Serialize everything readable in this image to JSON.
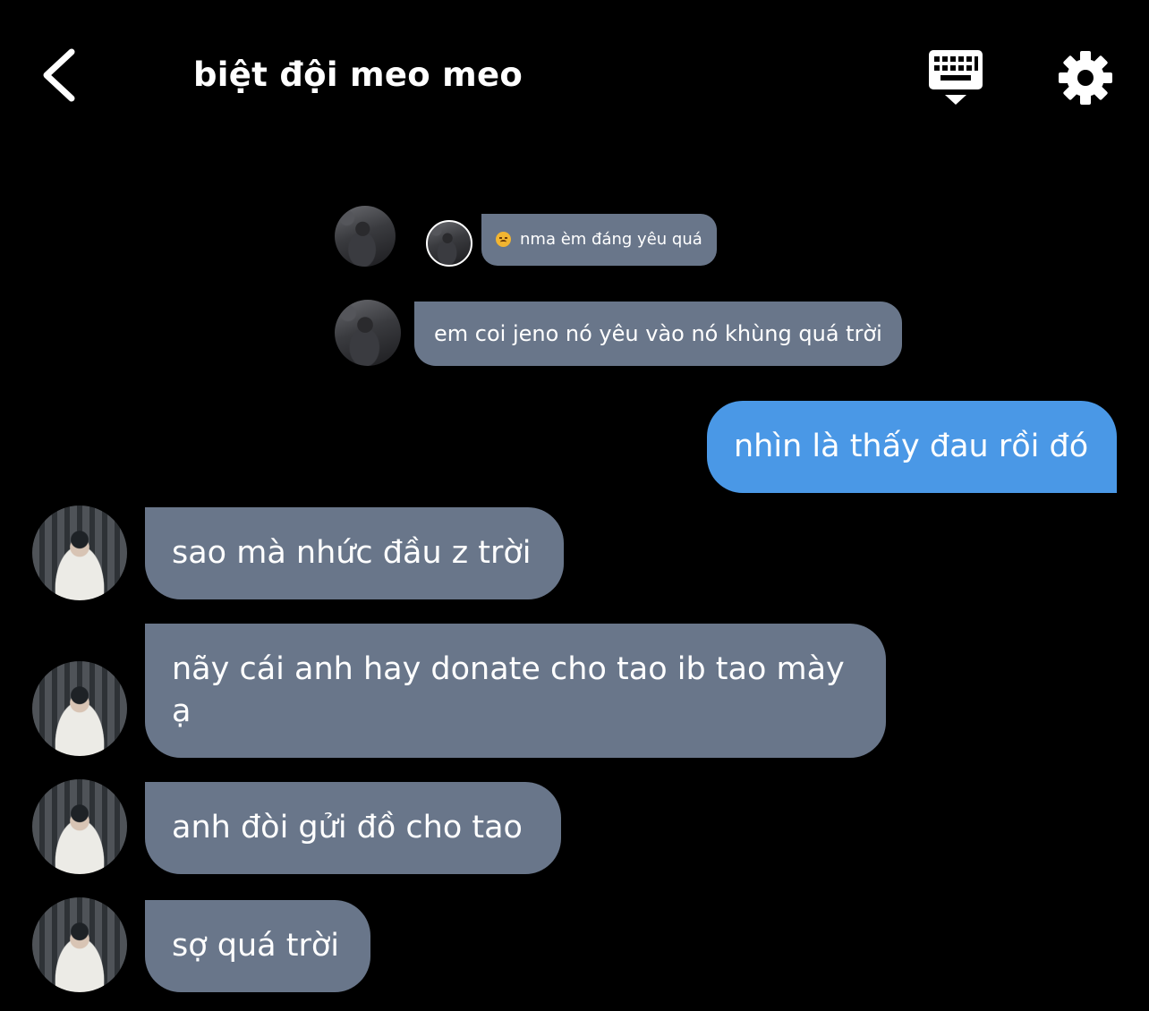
{
  "header": {
    "title": "biệt đội meo meo",
    "back_icon": "chevron-left-icon",
    "keyboard_icon": "keyboard-hide-icon",
    "settings_icon": "gear-icon"
  },
  "messages": [
    {
      "sender": "other",
      "text": "nma èm đáng yêu quá",
      "emoji": "disappointed-face-emoji",
      "size": "tiny",
      "avatar": "dark"
    },
    {
      "sender": "other",
      "text": "em coi jeno nó yêu vào nó khùng quá trời",
      "size": "small",
      "avatar": "dark"
    },
    {
      "sender": "me",
      "text": "nhìn là thấy đau rồi đó",
      "size": "large"
    },
    {
      "sender": "other",
      "text": "sao mà nhức đầu z trời",
      "size": "large",
      "avatar": "light"
    },
    {
      "sender": "other",
      "text": "nãy cái anh hay donate cho tao ib tao mày ạ",
      "size": "large",
      "avatar": "light"
    },
    {
      "sender": "other",
      "text": "anh đòi gửi đồ cho tao",
      "size": "large",
      "avatar": "light"
    },
    {
      "sender": "other",
      "text": "sợ quá trời",
      "size": "large",
      "avatar": "light"
    }
  ],
  "colors": {
    "background": "#000000",
    "incoming_bubble": "#69768a",
    "outgoing_bubble": "#4a98e6",
    "text": "#ffffff"
  }
}
